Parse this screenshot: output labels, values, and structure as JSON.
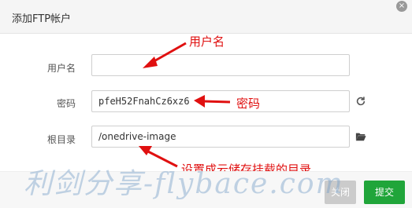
{
  "dialog": {
    "title": "添加FTP帐户",
    "close_label": "×"
  },
  "form": {
    "username": {
      "label": "用户名",
      "value": ""
    },
    "password": {
      "label": "密码",
      "value": "pfeH52FnahCz6xz6"
    },
    "root_dir": {
      "label": "根目录",
      "value": "/onedrive-image"
    }
  },
  "annotations": {
    "username": "用户名",
    "password": "密码",
    "root_dir": "设置成云储存挂载的目录",
    "color": "#e01010"
  },
  "buttons": {
    "close": "关闭",
    "submit": "提交"
  },
  "watermark": "利剑分享-flybace.com",
  "icons": {
    "refresh": "refresh-icon",
    "folder": "folder-open-icon"
  },
  "colors": {
    "submit": "#20a53a",
    "close_button": "#cbcbcb",
    "annotation": "#e01010"
  }
}
